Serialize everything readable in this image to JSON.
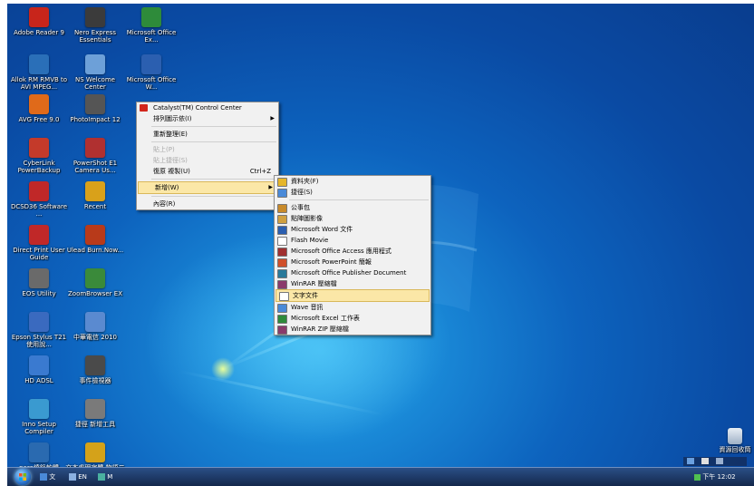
{
  "desktop_icons": [
    {
      "label": "Adobe Reader 9",
      "color": "#c8251b"
    },
    {
      "label": "Nero Express Essentials",
      "color": "#3b3b3b"
    },
    {
      "label": "Microsoft Office Ex...",
      "color": "#2e8b3a"
    },
    {
      "label": "Allok RM RMVB to AVI MPEG...",
      "color": "#2a6fb8"
    },
    {
      "label": "NS Welcome Center",
      "color": "#6da0d8"
    },
    {
      "label": "Microsoft Office W...",
      "color": "#2b5fb0"
    },
    {
      "label": "AVG Free 9.0",
      "color": "#e06a1a"
    },
    {
      "label": "PhotoImpact 12",
      "color": "#555555"
    },
    {
      "label": "CyberLink PowerBackup",
      "color": "#c43a2a"
    },
    {
      "label": "PowerShot E1 Camera Us...",
      "color": "#b03030"
    },
    {
      "label": "DCSD36 Software ...",
      "color": "#c02828"
    },
    {
      "label": "Recent",
      "color": "#d9a11a"
    },
    {
      "label": "Direct Print User Guide",
      "color": "#c02828"
    },
    {
      "label": "Ulead Burn.Now...",
      "color": "#b83a1a"
    },
    {
      "label": "EOS Utility",
      "color": "#6a6a6a"
    },
    {
      "label": "ZoomBrowser EX",
      "color": "#3a8a3a"
    },
    {
      "label": "Epson Stylus T21 使用說...",
      "color": "#3a6abf"
    },
    {
      "label": "中華電信 2010",
      "color": "#5a8ad0"
    },
    {
      "label": "HD ADSL",
      "color": "#3a7ad0"
    },
    {
      "label": "事件檢視器",
      "color": "#4a4a4a"
    },
    {
      "label": "Inno Setup Compiler",
      "color": "#3a9ad0"
    },
    {
      "label": "捷徑 新增工具",
      "color": "#7a7a7a"
    },
    {
      "label": "nero燒錄軟體",
      "color": "#2a6ab0"
    },
    {
      "label": "文本處理字體 物語二筆",
      "color": "#d4a21a"
    }
  ],
  "context_menu": {
    "items": [
      {
        "label": "Catalyst(TM) Control Center",
        "type": "item",
        "icon": "ati-icon"
      },
      {
        "label": "排列圖示依(I)",
        "type": "submenu"
      },
      {
        "label": "重新整理(E)",
        "type": "item"
      },
      {
        "label": "貼上(P)",
        "type": "disabled"
      },
      {
        "label": "貼上捷徑(S)",
        "type": "disabled"
      },
      {
        "label": "復原 複製(U)",
        "type": "item",
        "shortcut": "Ctrl+Z"
      },
      {
        "label": "新增(W)",
        "type": "submenu-hl"
      },
      {
        "label": "內容(R)",
        "type": "item"
      }
    ]
  },
  "new_submenu": {
    "items": [
      {
        "label": "資料夾(F)",
        "icon": "folder-icon",
        "color": "#e6b62a"
      },
      {
        "label": "捷徑(S)",
        "icon": "shortcut-icon",
        "color": "#4a8ad8"
      },
      {
        "label": "公事包",
        "icon": "briefcase-icon",
        "color": "#c88a2a"
      },
      {
        "label": "點陣圖影像",
        "icon": "bitmap-icon",
        "color": "#d0a040"
      },
      {
        "label": "Microsoft Word 文件",
        "icon": "word-icon",
        "color": "#2b5fb0"
      },
      {
        "label": "Flash Movie",
        "icon": "flash-icon",
        "color": "#ffffff"
      },
      {
        "label": "Microsoft Office Access 應用程式",
        "icon": "access-icon",
        "color": "#a03030"
      },
      {
        "label": "Microsoft PowerPoint 簡報",
        "icon": "powerpoint-icon",
        "color": "#d0502a"
      },
      {
        "label": "Microsoft Office Publisher Document",
        "icon": "publisher-icon",
        "color": "#2a7a9a"
      },
      {
        "label": "WinRAR 壓縮檔",
        "icon": "winrar-icon",
        "color": "#8a3a6a"
      },
      {
        "label": "文字文件",
        "icon": "text-file-icon",
        "color": "#ffffff",
        "highlight": true
      },
      {
        "label": "Wave 音訊",
        "icon": "wave-icon",
        "color": "#4a8ad8"
      },
      {
        "label": "Microsoft Excel 工作表",
        "icon": "excel-icon",
        "color": "#2e8b3a"
      },
      {
        "label": "WinRAR ZIP 壓縮檔",
        "icon": "winrar-zip-icon",
        "color": "#8a3a6a"
      }
    ]
  },
  "recycle_bin": {
    "label": "資源回收筒"
  },
  "taskbar": {
    "items": [
      "文",
      "EN",
      "M"
    ],
    "clock": "下午 12:02"
  },
  "colors": {
    "menu_bg": "#f1f1f1",
    "highlight": "#fbe7a7",
    "taskbar": "#1e3a6a"
  }
}
